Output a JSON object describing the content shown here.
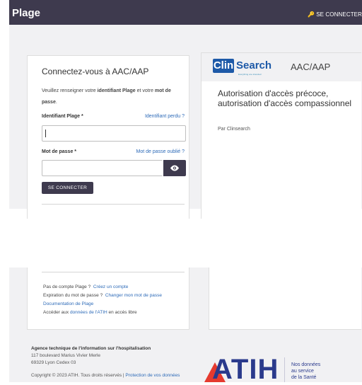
{
  "header": {
    "brand": "Plage",
    "login_link": "SE CONNECTER",
    "key_icon": "🔑"
  },
  "login": {
    "title": "Connectez-vous à AAC/AAP",
    "intro_part1": "Veuillez renseigner votre ",
    "intro_bold1": "identifiant Plage",
    "intro_part2": " et votre ",
    "intro_bold2": "mot de passe",
    "intro_end": ".",
    "id_label": "Identifiant Plage *",
    "id_forgot": "Identifiant perdu ?",
    "id_value": "",
    "pwd_label": "Mot de passe *",
    "pwd_forgot": "Mot de passe oublié ?",
    "pwd_value": "",
    "submit": "SE CONNECTER"
  },
  "service": {
    "logo_cl": "Cl",
    "logo_in": "in",
    "logo_search": "Search",
    "logo_tagline": "Everything one intended",
    "name": "AAC/AAP",
    "title": "Autorisation d'accès précoce, autorisation d'accès compassionnel",
    "by": "Par Clinsearch"
  },
  "help": {
    "no_account": "Pas de compte Plage ?",
    "create": "Créez un compte",
    "expired": "Expiration du mot de passe ?",
    "change": "Changer mon mot de passe",
    "docs": "Documentation de Plage",
    "access_pre": "Accéder aux ",
    "access_link": "données de l'ATIH",
    "access_post": " en accès libre"
  },
  "footer": {
    "agency": "Agence technique de l'information sur l'hospitalisation",
    "address1": "117 boulevard Marius Vivier Merle",
    "address2": "69329 Lyon Cedex 03",
    "copyright": "Copyright © 2023 ATIH. Tous droits réservés |",
    "privacy": "Protection de vos données",
    "logo": "ATIH",
    "tag1": "Nos données",
    "tag2": "au service",
    "tag3": "de la Santé"
  },
  "colors": {
    "topbar": "#3e3a4e",
    "link": "#2e6bb8",
    "clinsearch_blue": "#1e5aa8",
    "atih_blue": "#2a3a8c",
    "atih_red": "#e53a2f"
  }
}
